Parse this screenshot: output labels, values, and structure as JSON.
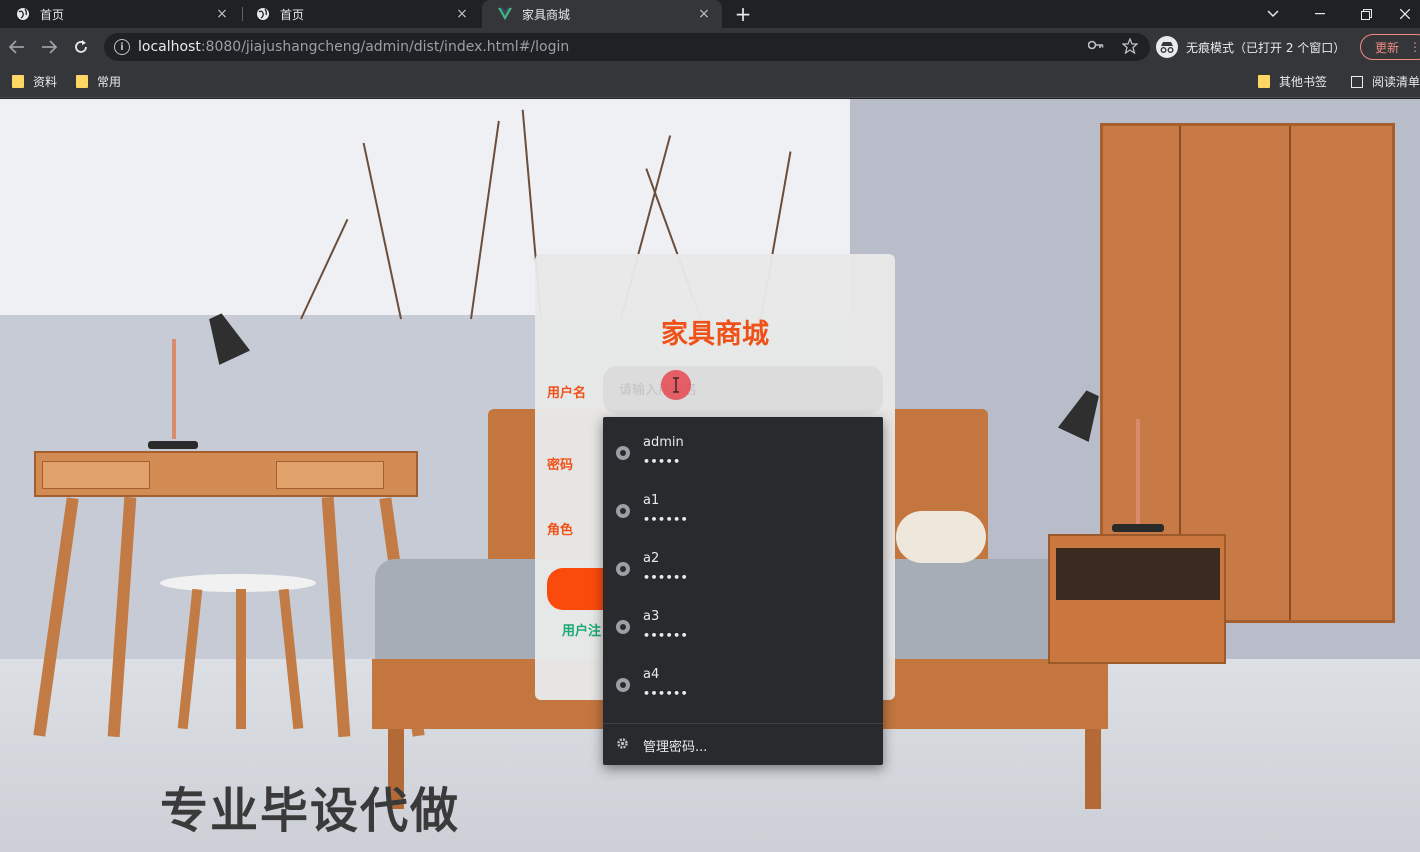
{
  "browser": {
    "tabs": [
      {
        "title": "首页",
        "icon": "globe-icon",
        "active": false
      },
      {
        "title": "首页",
        "icon": "globe-icon",
        "active": false
      },
      {
        "title": "家具商城",
        "icon": "vue-icon",
        "active": true
      }
    ],
    "close_glyph": "×",
    "new_tab_glyph": "+",
    "url_host": "localhost",
    "url_rest": ":8080/jiajushangcheng/admin/dist/index.html#/login",
    "incognito_label": "无痕模式（已打开 2 个窗口）",
    "update_label": "更新",
    "bookmarks": [
      {
        "label": "资料"
      },
      {
        "label": "常用"
      }
    ],
    "bookmarks_right": [
      {
        "label": "其他书签"
      },
      {
        "label": "阅读清单"
      }
    ]
  },
  "login": {
    "title": "家具商城",
    "username_label": "用户名",
    "username_placeholder": "请输入用户名",
    "password_label": "密码",
    "role_label": "角色",
    "register_link": "用户注"
  },
  "autofill": {
    "items": [
      {
        "username": "admin",
        "password_mask": "•••••"
      },
      {
        "username": "a1",
        "password_mask": "••••••"
      },
      {
        "username": "a2",
        "password_mask": "••••••"
      },
      {
        "username": "a3",
        "password_mask": "••••••"
      },
      {
        "username": "a4",
        "password_mask": "••••••"
      }
    ],
    "manage_label": "管理密码..."
  },
  "watermark": "专业毕设代做",
  "colors": {
    "accent": "#ef5218",
    "button": "#fb4b0c",
    "link": "#1ba872"
  }
}
